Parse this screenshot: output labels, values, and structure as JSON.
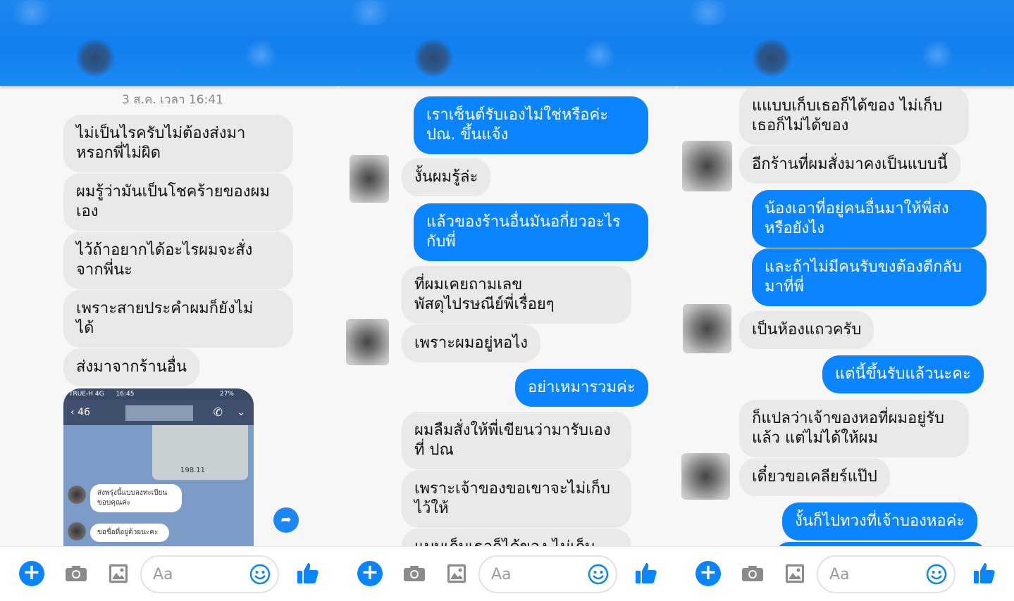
{
  "composer": {
    "placeholder": "Aa",
    "accent_color": "#0a84ff"
  },
  "panel1": {
    "timestamp": "3 ส.ค. เวลา 16:41",
    "messages": [
      "ไม่เป็นไรครับไม่ต้องส่งมา\nหรอกพี่ไม่ผิด",
      "ผมรู้ว่ามันเป็นโชคร้ายของผม\nเอง",
      "ไว้ถ้าอยากได้อะไรผมจะสั่ง\nจากพี่นะ",
      "เพราะสายประคำผมก็ยังไม่\nได้",
      "ส่งมาจากร้านอื่น"
    ],
    "embedded_screenshot": {
      "carrier": "TRUE-H  4G",
      "time": "16:45",
      "battery": "27%",
      "back": "46",
      "amount": "198.11",
      "msg1": "ส่งพรุ่งนี้แบบลงทะเบียน\nขอบคุณค่ะ",
      "msg2": "ขอชื่อที่อยู่ด้วยนะคะ"
    }
  },
  "panel2": {
    "messages": [
      {
        "dir": "out",
        "text": "เราเซ็นต์รับเองไม่ใช่หรือค่ะ\nปณ. ขึ้นแจ้ง"
      },
      {
        "dir": "in",
        "text": "งั้นผมรู้ล่ะ"
      },
      {
        "dir": "out",
        "text": "แล้วของร้านอื่นมันอกี่ยวอะไร\nกับพี่"
      },
      {
        "dir": "in",
        "text": "ที่ผมเคยถามเลข\nพัสดุไปรษณีย์พี่เรื่อยๆ"
      },
      {
        "dir": "in",
        "text": "เพราะผมอยู่หอไง"
      },
      {
        "dir": "out",
        "text": "อย่าเหมารวมค่ะ"
      },
      {
        "dir": "in",
        "text": "ผมลืมสั่งให้พี่เขียนว่ามารับเอง\nที่ ปณ"
      },
      {
        "dir": "in",
        "text": "เพราะเจ้าของขอเขาจะไม่เก็บ\nไว้ให้"
      },
      {
        "dir": "in",
        "text": "แบบเก็บเธอก็ได้ของ ไม่เก็บ"
      }
    ]
  },
  "panel3": {
    "messages": [
      {
        "dir": "in",
        "text": "แแบบเก็บเธอก็ได้ของ ไม่เก็บ\nเธอก็ไม่ได้ของ"
      },
      {
        "dir": "in",
        "text": "อีกร้านที่ผมสั่งมาคงเป็นแบบนี้"
      },
      {
        "dir": "out",
        "text": "น้องเอาที่อยู่คนอื่นมาให้พี่ส่ง\nหรือยังไง"
      },
      {
        "dir": "out",
        "text": "และถ้าไม่มีคนรับขงต้องตีกลับ\nมาที่พี่"
      },
      {
        "dir": "in",
        "text": "เป็นห้องแถวครับ"
      },
      {
        "dir": "out",
        "text": "แต่นี้ขึ้นรับแล้วนะคะ"
      },
      {
        "dir": "in",
        "text": "ก็แปลว่าเจ้าของหอที่ผมอยู่รับ\nแล้ว แต่ไม่ได้ให้ผม"
      },
      {
        "dir": "in",
        "text": "เดี๋ยวขอเคลียร์แป๊ป"
      },
      {
        "dir": "out",
        "text": "งั้นก็ไปทวงที่เจ้าบองหอค่ะ"
      }
    ]
  }
}
